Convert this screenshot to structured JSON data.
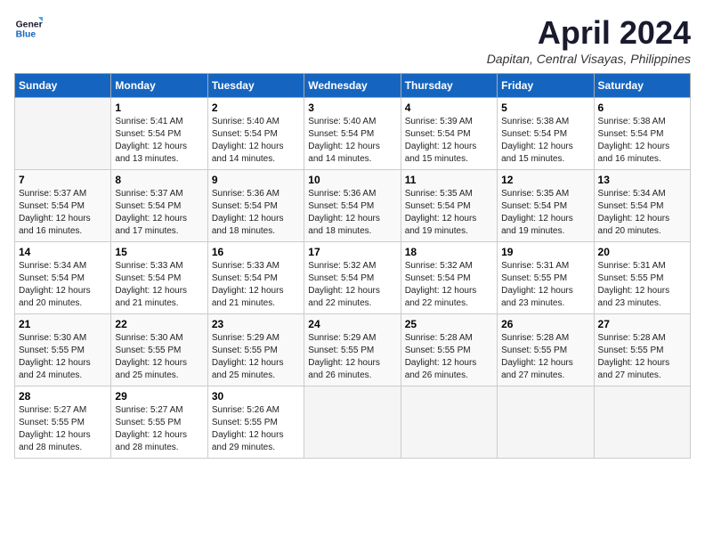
{
  "header": {
    "logo_line1": "General",
    "logo_line2": "Blue",
    "month_title": "April 2024",
    "subtitle": "Dapitan, Central Visayas, Philippines"
  },
  "weekdays": [
    "Sunday",
    "Monday",
    "Tuesday",
    "Wednesday",
    "Thursday",
    "Friday",
    "Saturday"
  ],
  "weeks": [
    [
      {
        "day": "",
        "info": ""
      },
      {
        "day": "1",
        "info": "Sunrise: 5:41 AM\nSunset: 5:54 PM\nDaylight: 12 hours\nand 13 minutes."
      },
      {
        "day": "2",
        "info": "Sunrise: 5:40 AM\nSunset: 5:54 PM\nDaylight: 12 hours\nand 14 minutes."
      },
      {
        "day": "3",
        "info": "Sunrise: 5:40 AM\nSunset: 5:54 PM\nDaylight: 12 hours\nand 14 minutes."
      },
      {
        "day": "4",
        "info": "Sunrise: 5:39 AM\nSunset: 5:54 PM\nDaylight: 12 hours\nand 15 minutes."
      },
      {
        "day": "5",
        "info": "Sunrise: 5:38 AM\nSunset: 5:54 PM\nDaylight: 12 hours\nand 15 minutes."
      },
      {
        "day": "6",
        "info": "Sunrise: 5:38 AM\nSunset: 5:54 PM\nDaylight: 12 hours\nand 16 minutes."
      }
    ],
    [
      {
        "day": "7",
        "info": "Sunrise: 5:37 AM\nSunset: 5:54 PM\nDaylight: 12 hours\nand 16 minutes."
      },
      {
        "day": "8",
        "info": "Sunrise: 5:37 AM\nSunset: 5:54 PM\nDaylight: 12 hours\nand 17 minutes."
      },
      {
        "day": "9",
        "info": "Sunrise: 5:36 AM\nSunset: 5:54 PM\nDaylight: 12 hours\nand 18 minutes."
      },
      {
        "day": "10",
        "info": "Sunrise: 5:36 AM\nSunset: 5:54 PM\nDaylight: 12 hours\nand 18 minutes."
      },
      {
        "day": "11",
        "info": "Sunrise: 5:35 AM\nSunset: 5:54 PM\nDaylight: 12 hours\nand 19 minutes."
      },
      {
        "day": "12",
        "info": "Sunrise: 5:35 AM\nSunset: 5:54 PM\nDaylight: 12 hours\nand 19 minutes."
      },
      {
        "day": "13",
        "info": "Sunrise: 5:34 AM\nSunset: 5:54 PM\nDaylight: 12 hours\nand 20 minutes."
      }
    ],
    [
      {
        "day": "14",
        "info": "Sunrise: 5:34 AM\nSunset: 5:54 PM\nDaylight: 12 hours\nand 20 minutes."
      },
      {
        "day": "15",
        "info": "Sunrise: 5:33 AM\nSunset: 5:54 PM\nDaylight: 12 hours\nand 21 minutes."
      },
      {
        "day": "16",
        "info": "Sunrise: 5:33 AM\nSunset: 5:54 PM\nDaylight: 12 hours\nand 21 minutes."
      },
      {
        "day": "17",
        "info": "Sunrise: 5:32 AM\nSunset: 5:54 PM\nDaylight: 12 hours\nand 22 minutes."
      },
      {
        "day": "18",
        "info": "Sunrise: 5:32 AM\nSunset: 5:54 PM\nDaylight: 12 hours\nand 22 minutes."
      },
      {
        "day": "19",
        "info": "Sunrise: 5:31 AM\nSunset: 5:55 PM\nDaylight: 12 hours\nand 23 minutes."
      },
      {
        "day": "20",
        "info": "Sunrise: 5:31 AM\nSunset: 5:55 PM\nDaylight: 12 hours\nand 23 minutes."
      }
    ],
    [
      {
        "day": "21",
        "info": "Sunrise: 5:30 AM\nSunset: 5:55 PM\nDaylight: 12 hours\nand 24 minutes."
      },
      {
        "day": "22",
        "info": "Sunrise: 5:30 AM\nSunset: 5:55 PM\nDaylight: 12 hours\nand 25 minutes."
      },
      {
        "day": "23",
        "info": "Sunrise: 5:29 AM\nSunset: 5:55 PM\nDaylight: 12 hours\nand 25 minutes."
      },
      {
        "day": "24",
        "info": "Sunrise: 5:29 AM\nSunset: 5:55 PM\nDaylight: 12 hours\nand 26 minutes."
      },
      {
        "day": "25",
        "info": "Sunrise: 5:28 AM\nSunset: 5:55 PM\nDaylight: 12 hours\nand 26 minutes."
      },
      {
        "day": "26",
        "info": "Sunrise: 5:28 AM\nSunset: 5:55 PM\nDaylight: 12 hours\nand 27 minutes."
      },
      {
        "day": "27",
        "info": "Sunrise: 5:28 AM\nSunset: 5:55 PM\nDaylight: 12 hours\nand 27 minutes."
      }
    ],
    [
      {
        "day": "28",
        "info": "Sunrise: 5:27 AM\nSunset: 5:55 PM\nDaylight: 12 hours\nand 28 minutes."
      },
      {
        "day": "29",
        "info": "Sunrise: 5:27 AM\nSunset: 5:55 PM\nDaylight: 12 hours\nand 28 minutes."
      },
      {
        "day": "30",
        "info": "Sunrise: 5:26 AM\nSunset: 5:55 PM\nDaylight: 12 hours\nand 29 minutes."
      },
      {
        "day": "",
        "info": ""
      },
      {
        "day": "",
        "info": ""
      },
      {
        "day": "",
        "info": ""
      },
      {
        "day": "",
        "info": ""
      }
    ]
  ]
}
